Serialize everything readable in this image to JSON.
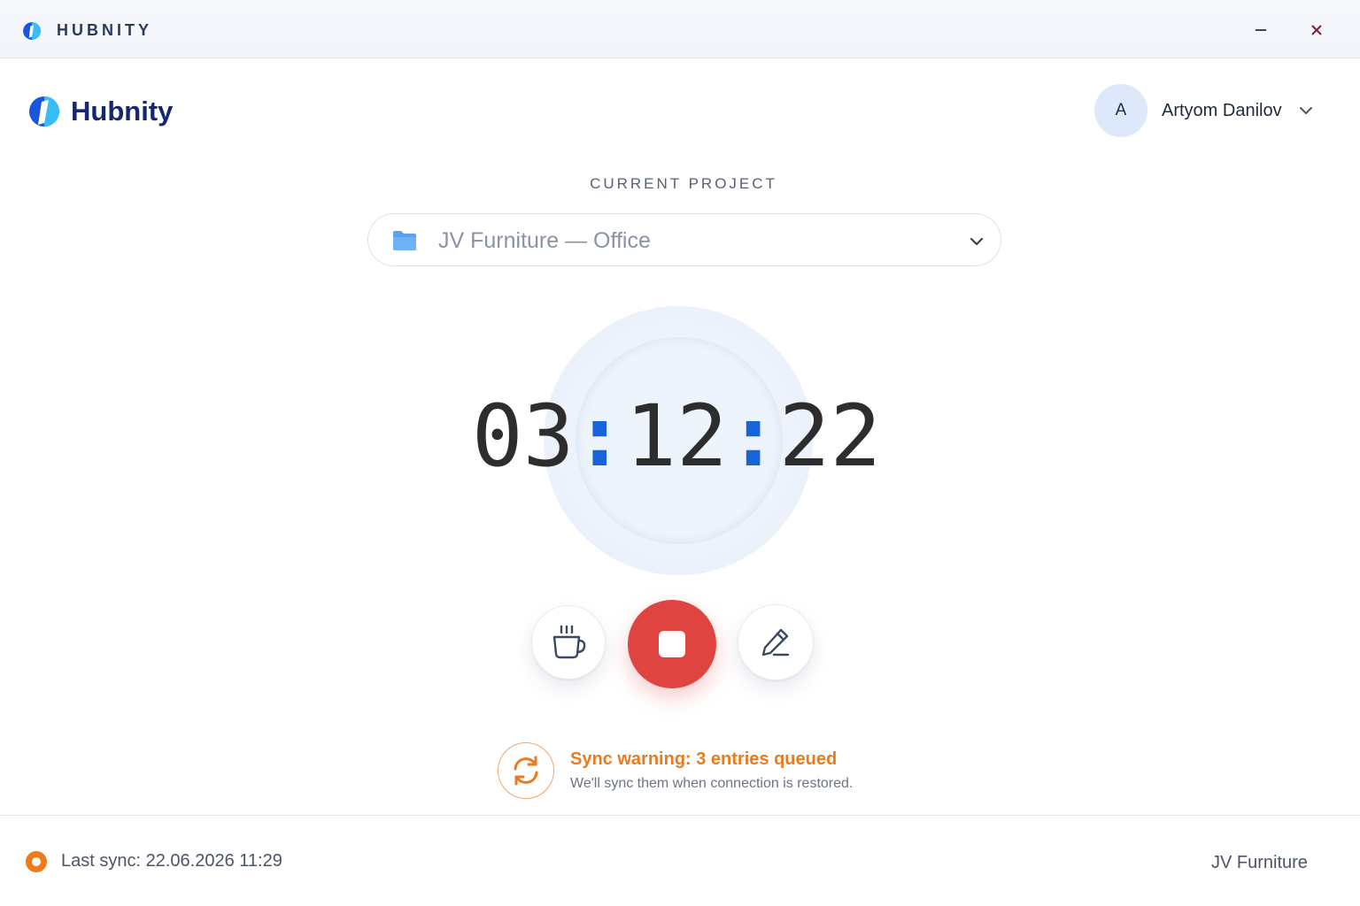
{
  "window": {
    "title": "HUBNITY",
    "minimize_icon": "minimize-icon",
    "close_icon": "close-icon"
  },
  "header": {
    "brand_name": "Hubnity",
    "user": {
      "avatar_initial": "A",
      "name": "Artyom Danilov"
    }
  },
  "project": {
    "label": "CURRENT PROJECT",
    "selected": "JV Furniture — Office"
  },
  "timer": {
    "hours": "03",
    "minutes": "12",
    "seconds": "22",
    "separator": ":"
  },
  "controls": {
    "break_icon": "coffee-cup-icon",
    "stop_icon": "stop-icon",
    "edit_icon": "pencil-icon"
  },
  "sync_warning": {
    "title": "Sync warning: 3 entries queued",
    "message": "We'll sync them when connection is restored."
  },
  "footer": {
    "last_sync": "Last sync: 22.06.2026 11:29",
    "workspace": "JV Furniture"
  },
  "colors": {
    "accent": "#1565d8",
    "brand": "#14286b",
    "stop": "#e04441",
    "warning": "#ec7a1c"
  }
}
